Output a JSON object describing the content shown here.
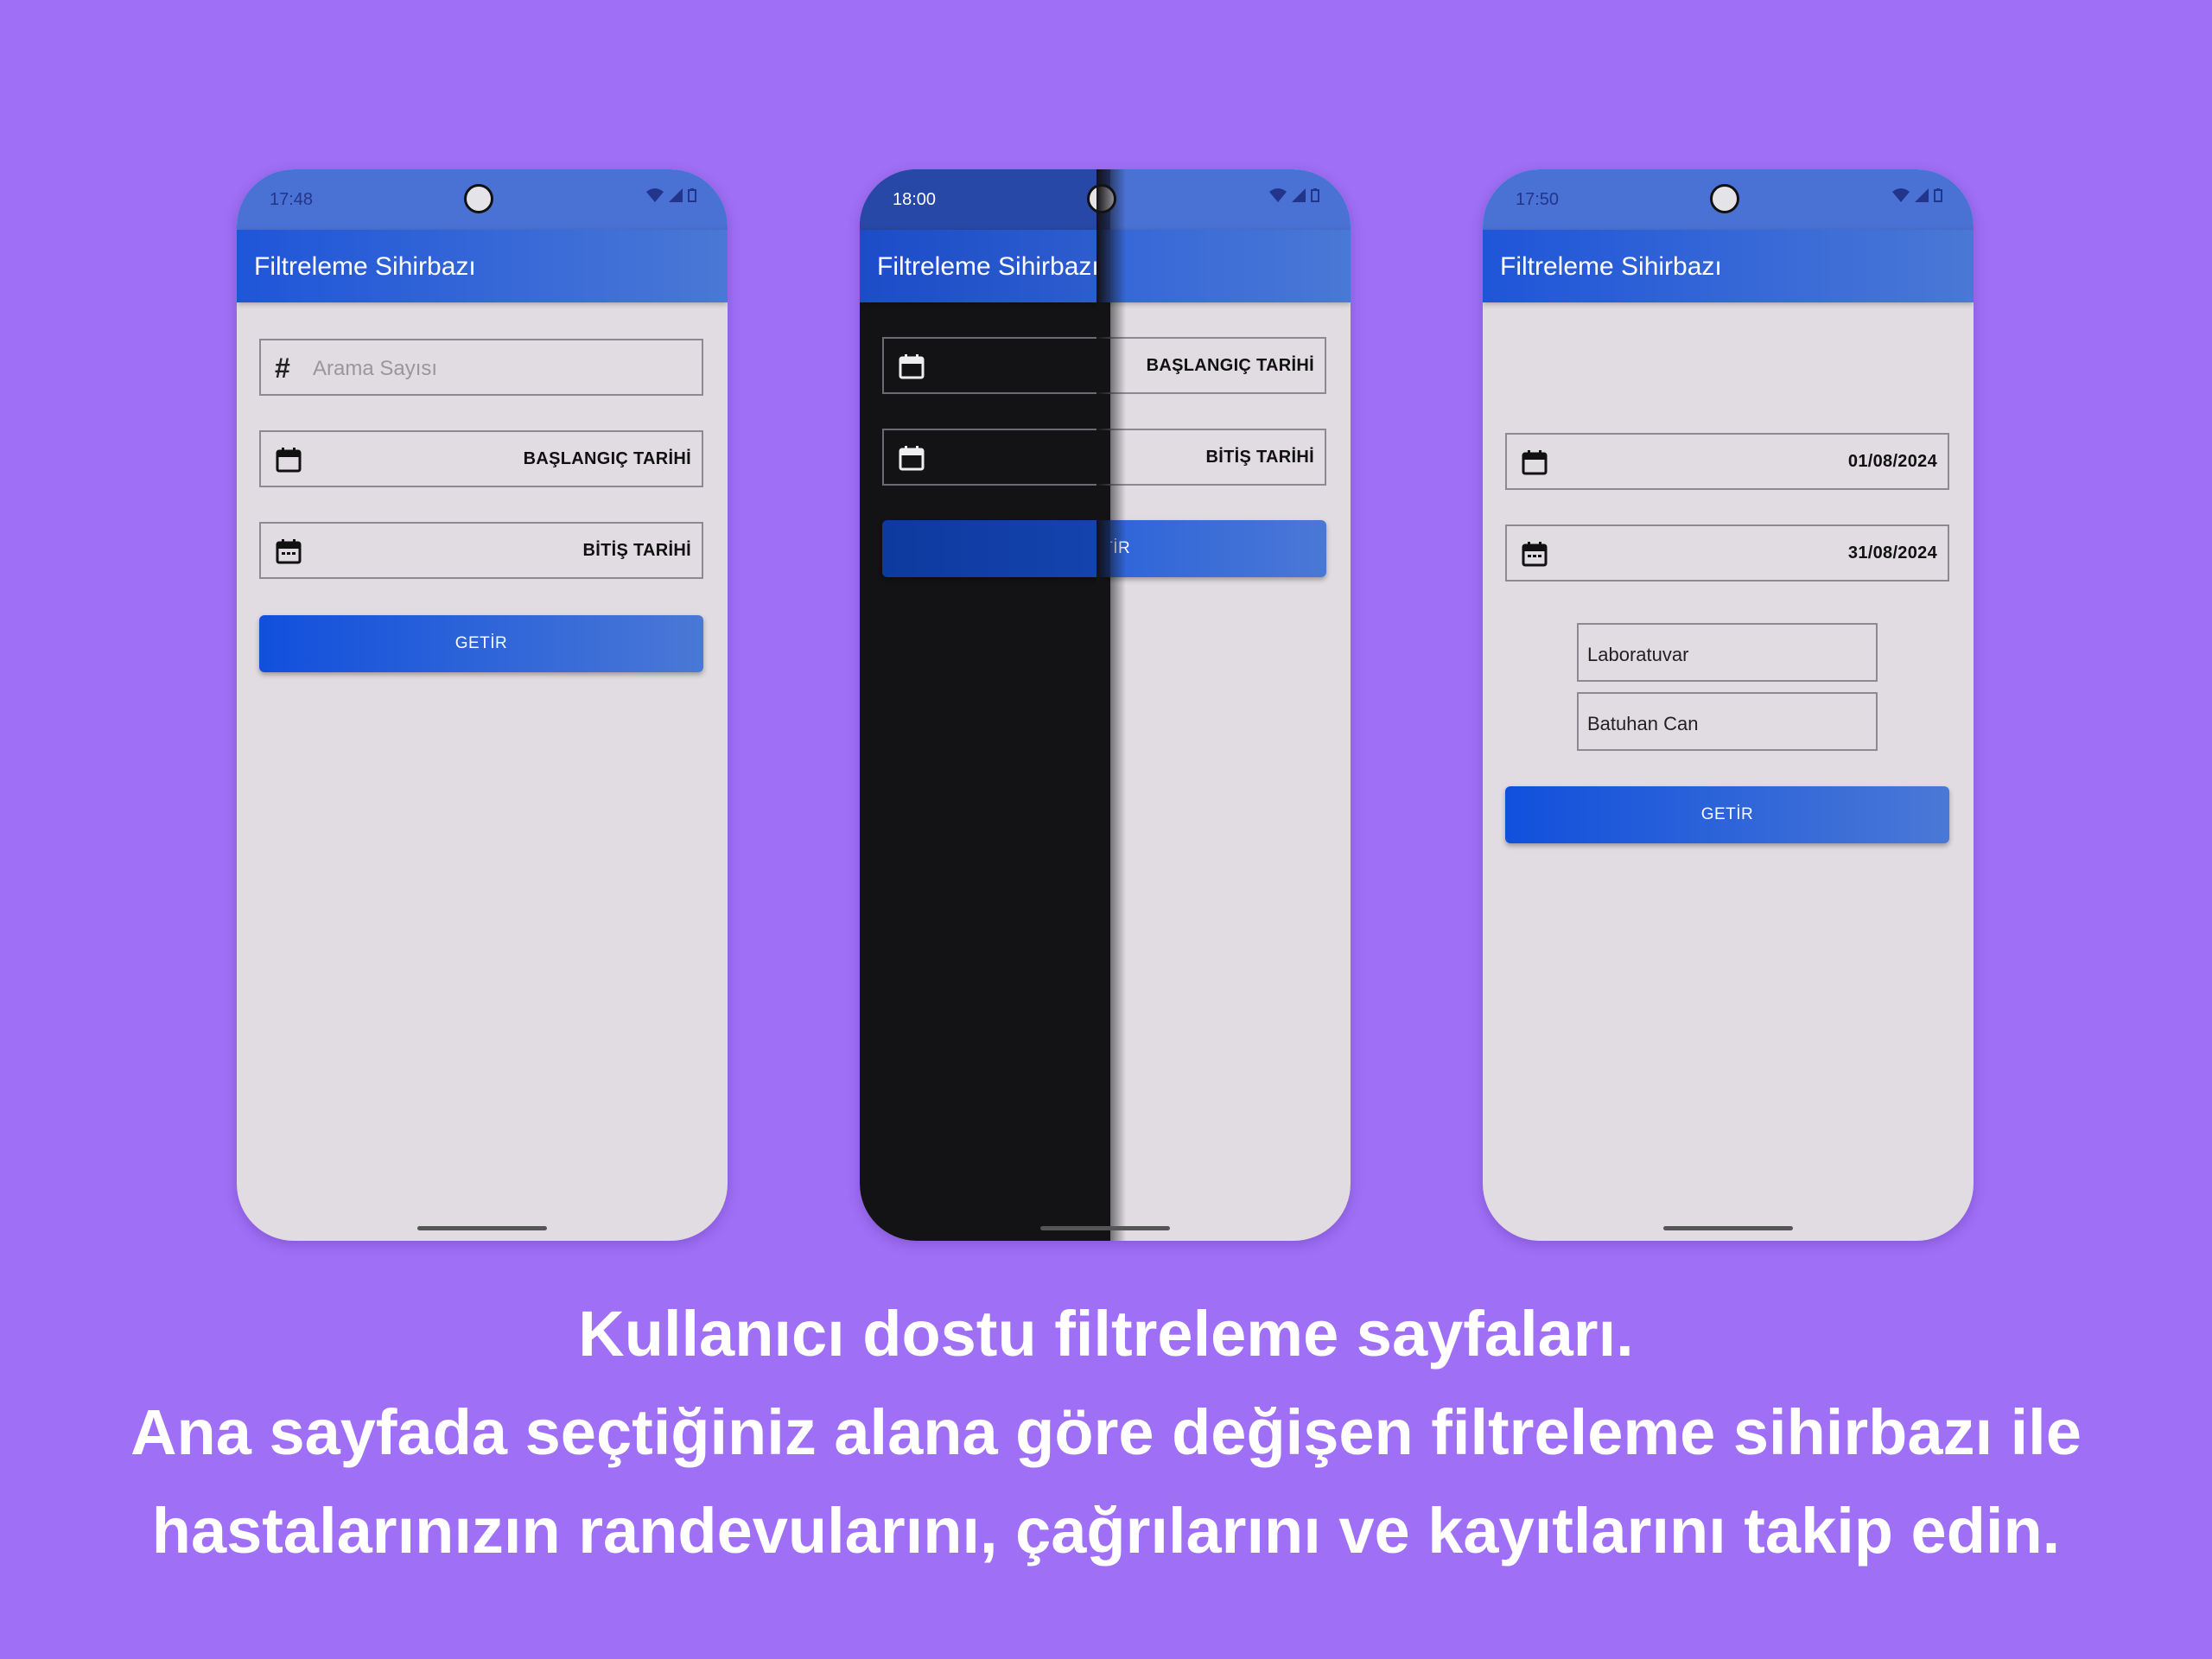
{
  "colors": {
    "background": "#9f6ff5",
    "app_bar": "#2a5fd6",
    "button": "#1150dc",
    "screen_light": "#e0dce1",
    "screen_dark": "#131215"
  },
  "phones": [
    {
      "time": "17:48",
      "app_title": "Filtreleme Sihirbazı",
      "search_placeholder": "Arama Sayısı",
      "start_date": "BAŞLANGIÇ TARİHİ",
      "end_date": "BİTİŞ TARİHİ",
      "button": "GETİR"
    },
    {
      "time": "18:00",
      "app_title": "Filtreleme Sihirbazı",
      "start_date": "BAŞLANGIÇ TARİHİ",
      "end_date": "BİTİŞ TARİHİ",
      "button": "GETİR"
    },
    {
      "time": "17:50",
      "app_title": "Filtreleme Sihirbazı",
      "start_date": "01/08/2024",
      "end_date": "31/08/2024",
      "department": "Laboratuvar",
      "person": "Batuhan Can",
      "button": "GETİR"
    }
  ],
  "caption": {
    "line1": "Kullanıcı dostu filtreleme sayfaları.",
    "line2": "Ana sayfada seçtiğiniz alana göre değişen filtreleme sihirbazı ile",
    "line3": "hastalarınızın randevularını, çağrılarını ve kayıtlarını takip edin."
  }
}
